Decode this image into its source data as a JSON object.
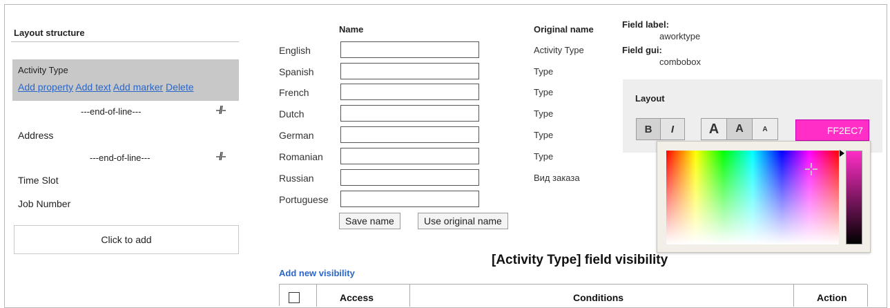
{
  "layout_structure": {
    "title": "Layout structure",
    "selected_item": {
      "label": "Activity Type",
      "links": [
        "Add property",
        "Add text",
        "Add marker",
        "Delete"
      ]
    },
    "end_of_line_text": "---end-of-line---",
    "fields": [
      "Address",
      "Time Slot",
      "Job Number"
    ],
    "click_to_add": "Click to add"
  },
  "names_form": {
    "name_header": "Name",
    "original_header": "Original name",
    "rows": [
      {
        "language": "English",
        "value": "",
        "original": "Activity Type"
      },
      {
        "language": "Spanish",
        "value": "",
        "original": "Type"
      },
      {
        "language": "French",
        "value": "",
        "original": "Type"
      },
      {
        "language": "Dutch",
        "value": "",
        "original": "Type"
      },
      {
        "language": "German",
        "value": "",
        "original": "Type"
      },
      {
        "language": "Romanian",
        "value": "",
        "original": "Type"
      },
      {
        "language": "Russian",
        "value": "",
        "original": "Вид заказа"
      },
      {
        "language": "Portuguese",
        "value": "",
        "original": ""
      }
    ],
    "save_button": "Save name",
    "use_original_button": "Use original name"
  },
  "field_info": {
    "label_title": "Field label:",
    "label_value": "aworktype",
    "gui_title": "Field gui:",
    "gui_value": "combobox"
  },
  "layout_panel": {
    "title": "Layout",
    "bold": "B",
    "italic": "I",
    "size_large": "A",
    "size_medium": "A",
    "size_small": "A",
    "color_value": "FF2EC7",
    "selected_color": "#ff2ec7"
  },
  "visibility": {
    "title": "[Activity Type] field visibility",
    "add_link": "Add new visibility",
    "columns": [
      "Access",
      "Conditions",
      "Action"
    ]
  }
}
